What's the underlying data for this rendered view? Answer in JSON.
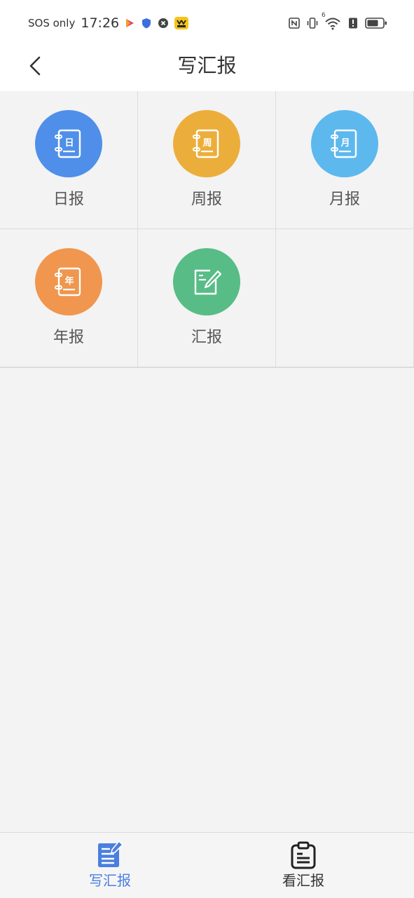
{
  "status_bar": {
    "carrier_text": "SOS only",
    "time": "17:26",
    "icons": [
      "video-app-icon",
      "shield-icon",
      "security-icon",
      "yellow-app-icon",
      "nfc-icon",
      "vibrate-icon",
      "wifi-icon",
      "alert-icon",
      "battery-icon"
    ],
    "wifi_badge": "6"
  },
  "nav": {
    "title": "写汇报",
    "back_icon": "chevron-left-icon"
  },
  "report_types": [
    {
      "label": "日报",
      "glyph": "日",
      "color": "#4f8fe9",
      "icon": "daily-notebook-icon"
    },
    {
      "label": "周报",
      "glyph": "周",
      "color": "#ecae3b",
      "icon": "weekly-notebook-icon"
    },
    {
      "label": "月报",
      "glyph": "月",
      "color": "#5db8ee",
      "icon": "monthly-notebook-icon"
    },
    {
      "label": "年报",
      "glyph": "年",
      "color": "#f0964e",
      "icon": "yearly-notebook-icon"
    },
    {
      "label": "汇报",
      "glyph": "",
      "color": "#58bc86",
      "icon": "edit-report-icon"
    }
  ],
  "tabs": [
    {
      "label": "写汇报",
      "icon": "write-report-icon",
      "active": true,
      "color": "#4a7fe0"
    },
    {
      "label": "看汇报",
      "icon": "view-report-icon",
      "active": false,
      "color": "#333333"
    }
  ]
}
